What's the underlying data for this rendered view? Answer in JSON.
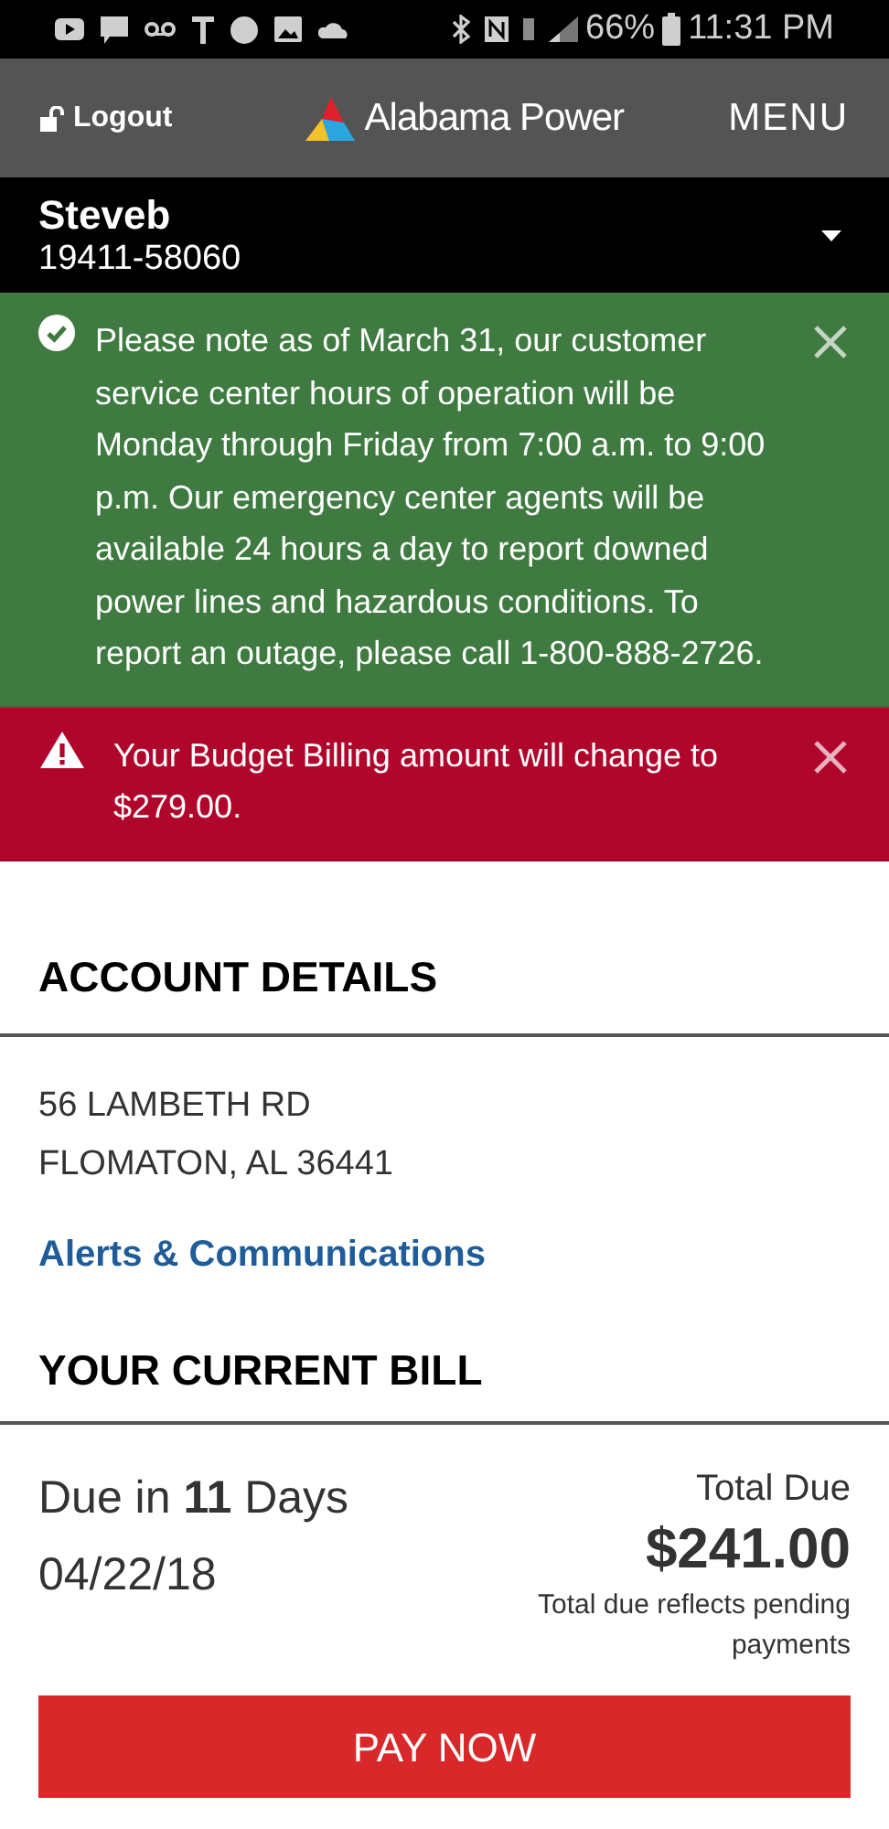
{
  "status_bar": {
    "battery": "66%",
    "time": "11:31 PM"
  },
  "header": {
    "logout": "Logout",
    "brand": "Alabama Power",
    "menu": "MENU"
  },
  "account": {
    "name": "Steveb",
    "number": "19411-58060"
  },
  "alerts": [
    {
      "kind": "success",
      "text": "Please note as of March 31, our customer service center hours of operation will be Monday through Friday from 7:00 a.m. to 9:00 p.m. Our emergency center agents will be available 24 hours a day to report downed power lines and hazardous conditions. To report an outage, please call 1-800-888-2726."
    },
    {
      "kind": "warning",
      "text": "Your Budget Billing amount will change to $279.00."
    }
  ],
  "account_details": {
    "heading": "ACCOUNT DETAILS",
    "address_line_1": "56 LAMBETH RD",
    "address_line_2": "FLOMATON, AL 36441",
    "link": "Alerts & Communications"
  },
  "current_bill": {
    "heading": "YOUR CURRENT BILL",
    "due": "Due in **11** Days",
    "due_date": "04/22/18",
    "total_label": "Total Due",
    "total": "$241.00",
    "note": "Total due reflects pending payments",
    "pay_button": "PAY NOW"
  }
}
